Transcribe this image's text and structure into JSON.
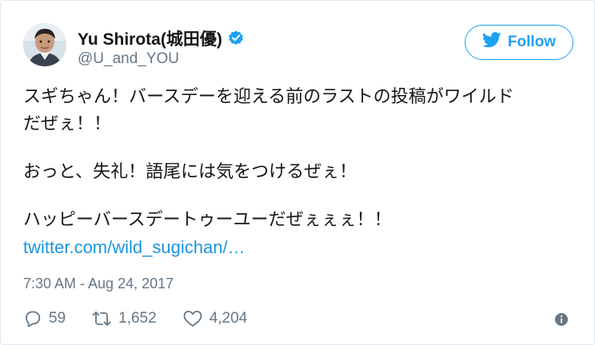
{
  "tweet": {
    "author": {
      "name": "Yu Shirota(城田優)",
      "handle": "@U_and_YOU",
      "verified": true
    },
    "follow_label": "Follow",
    "text_lines": [
      "スギちゃん！バースデーを迎える前のラストの投稿がワイルド",
      "だぜぇ！！",
      "おっと、失礼！語尾には気をつけるぜぇ！",
      "ハッピーバースデートゥーユーだぜぇぇぇ！！"
    ],
    "link": "twitter.com/wild_sugichan/…",
    "timestamp": "7:30 AM - Aug 24, 2017",
    "stats": {
      "replies": "59",
      "retweets": "1,652",
      "likes": "4,204"
    }
  },
  "icons": {
    "verified": "verified-badge-icon",
    "follow": "twitter-bird-icon",
    "reply": "reply-icon",
    "retweet": "retweet-icon",
    "like": "heart-icon",
    "info": "info-icon"
  },
  "colors": {
    "accent": "#1da1f2",
    "link": "#1b95e0",
    "muted": "#657786",
    "text": "#14171a"
  }
}
